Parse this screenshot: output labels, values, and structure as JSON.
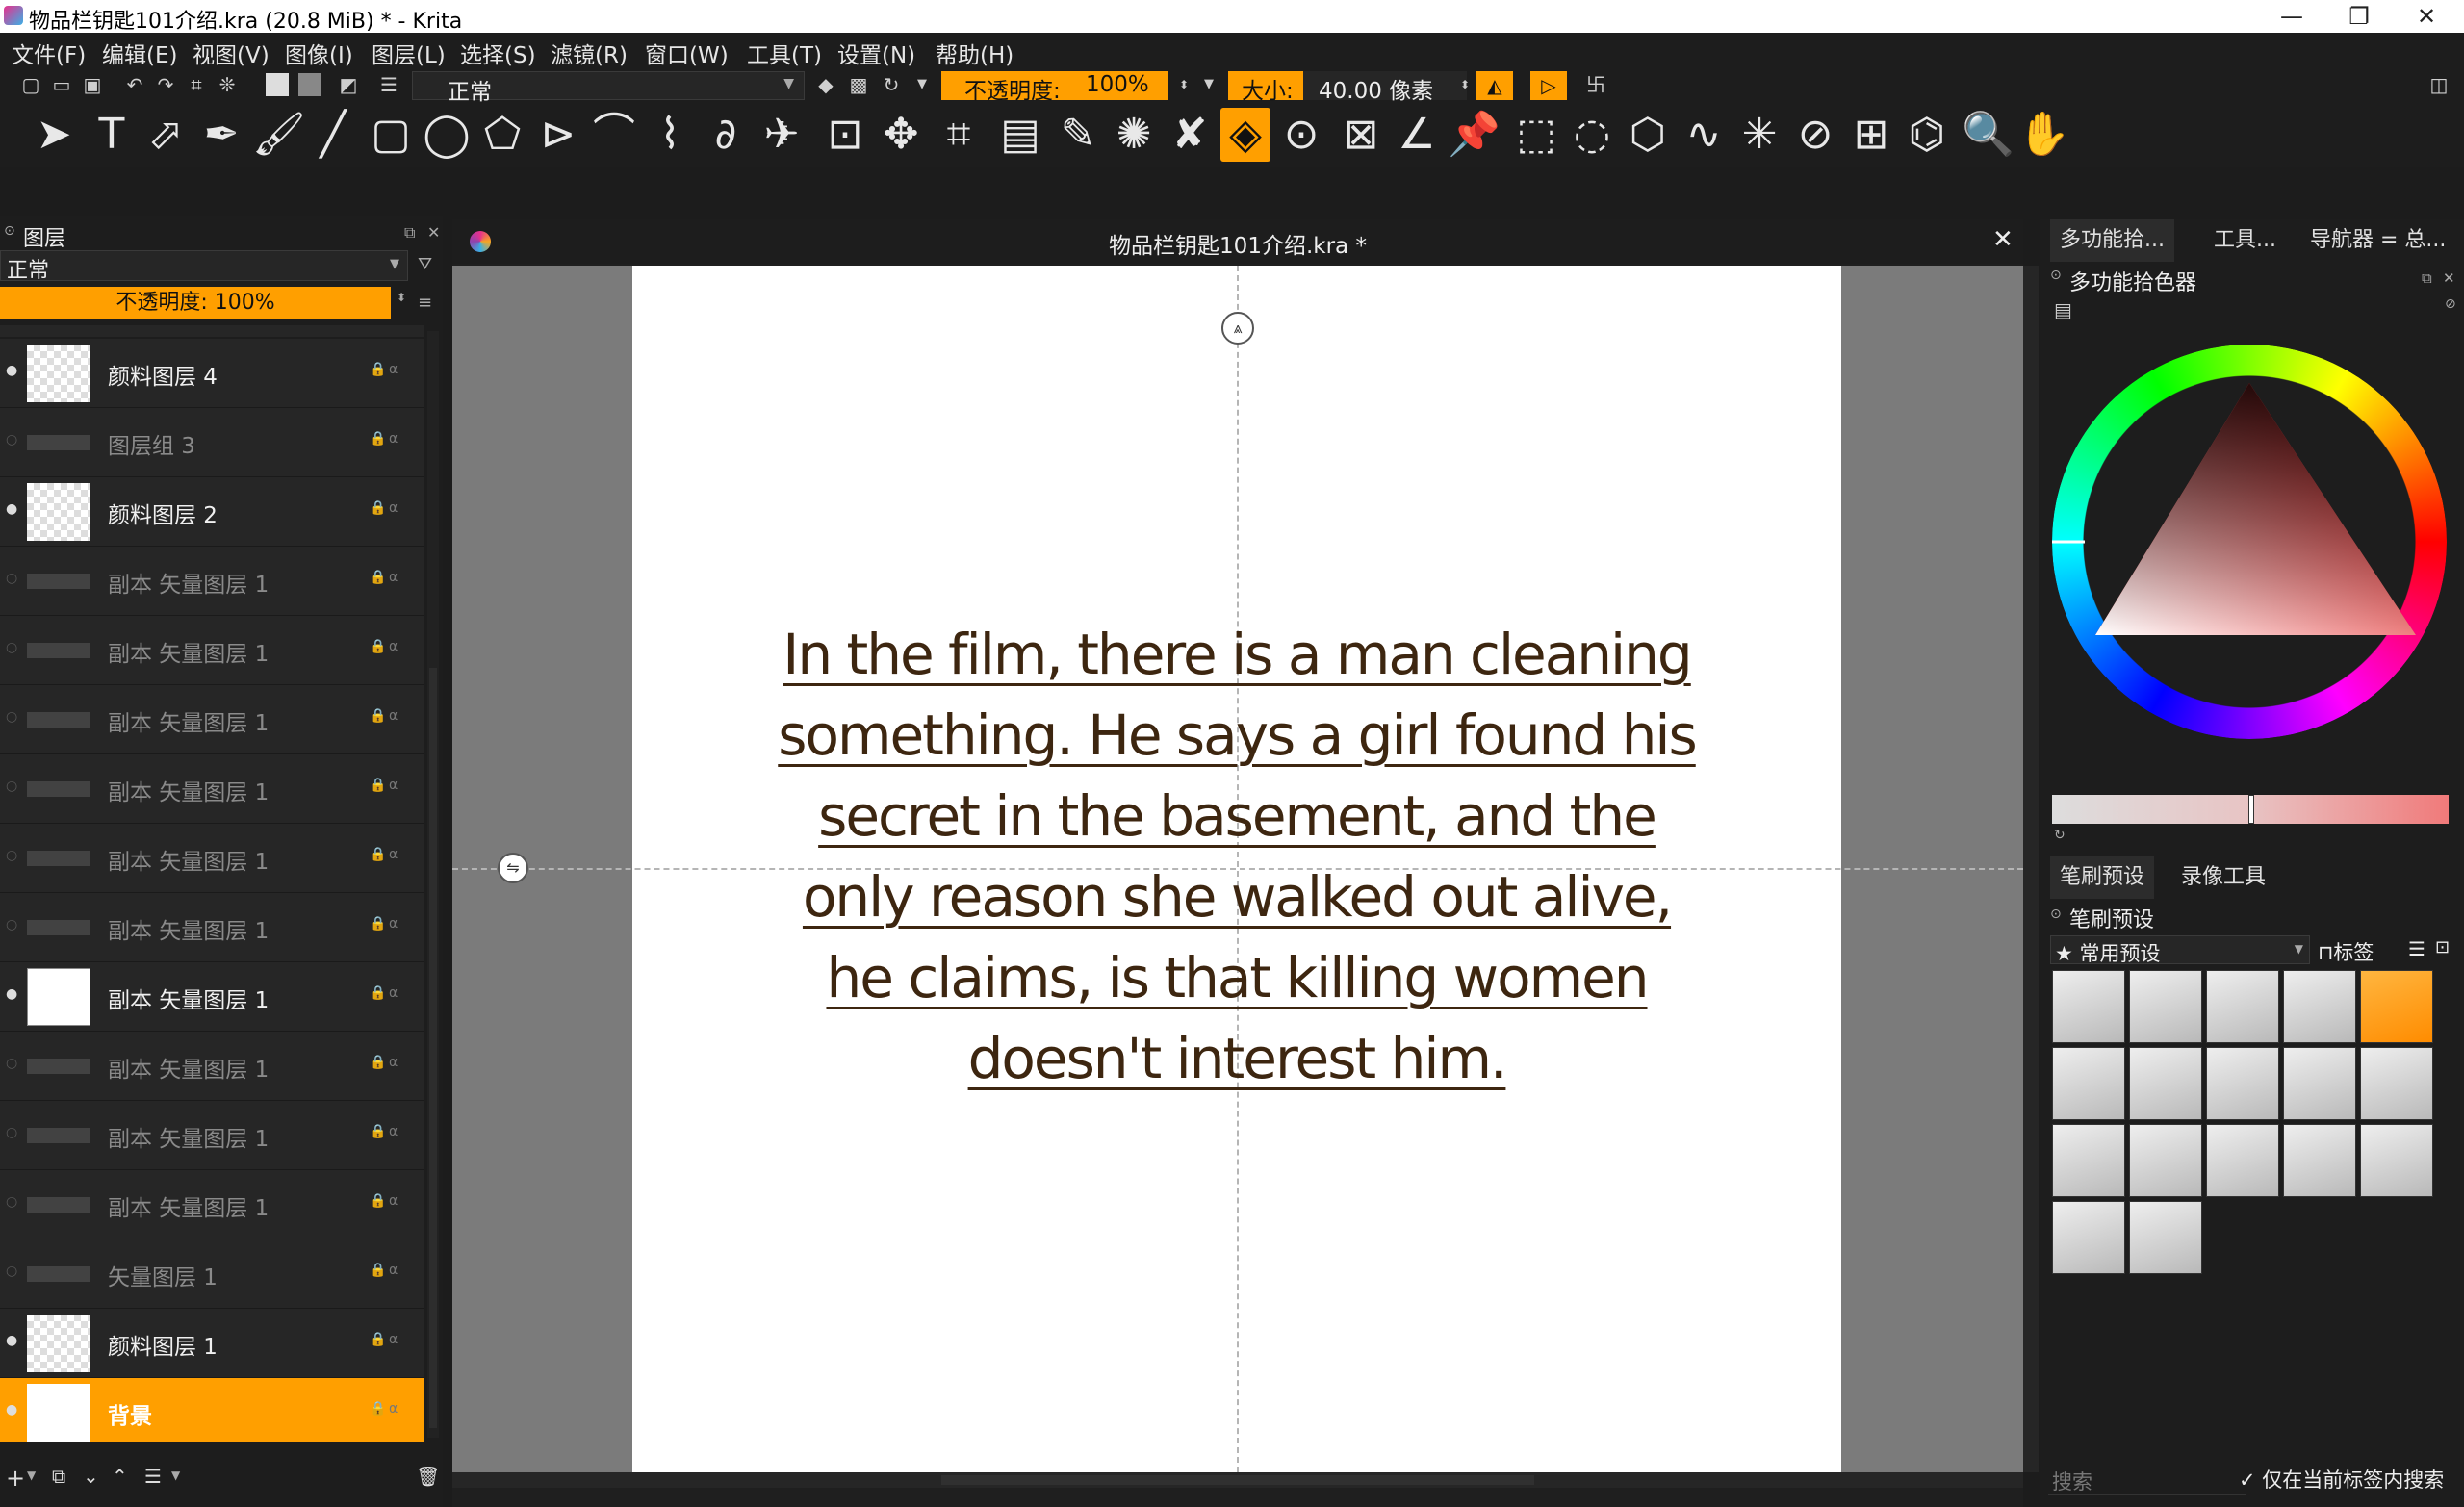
{
  "window": {
    "title": "物品栏钥匙101介绍.kra (20.8 MiB)  * - Krita",
    "minimize": "—",
    "maximize": "❐",
    "close": "✕"
  },
  "menu": [
    "文件(F)",
    "编辑(E)",
    "视图(V)",
    "图像(I)",
    "图层(L)",
    "选择(S)",
    "滤镜(R)",
    "窗口(W)",
    "工具(T)",
    "设置(N)",
    "帮助(H)"
  ],
  "toolbar": {
    "blend_mode": "正常",
    "opacity_label": "不透明度:",
    "opacity_value": "100%",
    "size_label": "大小:",
    "size_value": "40.00 像素"
  },
  "layers_panel": {
    "title": "图层",
    "blend_mode": "正常",
    "opacity": "不透明度:  100%",
    "layers": [
      {
        "name": "颜料图层 4",
        "type": "paint",
        "visible": true
      },
      {
        "name": "图层组 3",
        "type": "group",
        "visible": false
      },
      {
        "name": "颜料图层 2",
        "type": "paint",
        "visible": true
      },
      {
        "name": "副本 矢量图层 1",
        "type": "vector",
        "visible": false
      },
      {
        "name": "副本 矢量图层 1",
        "type": "vector",
        "visible": false
      },
      {
        "name": "副本 矢量图层 1",
        "type": "vector",
        "visible": false
      },
      {
        "name": "副本 矢量图层 1",
        "type": "vector",
        "visible": false
      },
      {
        "name": "副本 矢量图层 1",
        "type": "vector",
        "visible": false
      },
      {
        "name": "副本 矢量图层 1",
        "type": "vector",
        "visible": false
      },
      {
        "name": "副本 矢量图层 1",
        "type": "vector-active",
        "visible": true
      },
      {
        "name": "副本 矢量图层 1",
        "type": "vector",
        "visible": false
      },
      {
        "name": "副本 矢量图层 1",
        "type": "vector",
        "visible": false
      },
      {
        "name": "副本 矢量图层 1",
        "type": "vector",
        "visible": false
      },
      {
        "name": "矢量图层 1",
        "type": "vector",
        "visible": false
      },
      {
        "name": "颜料图层 1",
        "type": "paint",
        "visible": true
      },
      {
        "name": "背景",
        "type": "background",
        "visible": true
      }
    ]
  },
  "document": {
    "tab_title": "物品栏钥匙101介绍.kra *",
    "text_lines": [
      "In the film, there is a man cleaning",
      "something. He says a girl found his",
      "secret in the basement, and the",
      "only reason she walked out alive,",
      "he claims, is that killing women",
      "doesn't interest him."
    ]
  },
  "right_dock": {
    "tabs": [
      "多功能拾...",
      "工具...",
      "导航器 = 总..."
    ],
    "color_selector_title": "多功能拾色器",
    "bottom_tabs": [
      "笔刷预设",
      "录像工具"
    ],
    "brush_presets_title": "笔刷预设",
    "preset_filter": "★ 常用预设",
    "tag_label": "标签",
    "search_placeholder": "搜索",
    "only_current_tag": "✓ 仅在当前标签内搜索"
  },
  "colors": {
    "accent": "#ff9f00",
    "text_color": "#3d2610"
  }
}
